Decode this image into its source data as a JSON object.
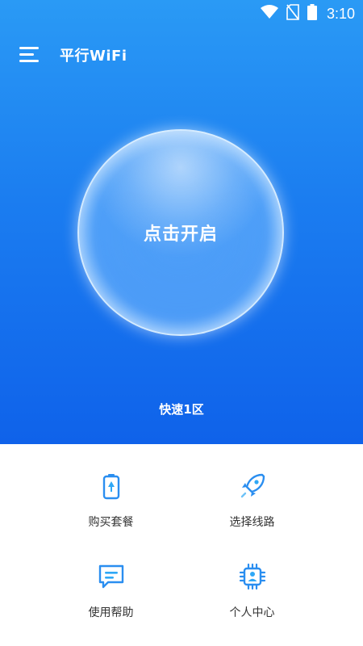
{
  "status_bar": {
    "time": "3:10",
    "icons": [
      "wifi-icon",
      "no-sim-icon",
      "battery-icon"
    ]
  },
  "app_bar": {
    "menu_icon": "menu-icon",
    "title": "平行WiFi"
  },
  "connect": {
    "button_label": "点击开启",
    "server_name": "快速1区"
  },
  "features": [
    {
      "label": "购买套餐",
      "icon": "battery-icon"
    },
    {
      "label": "选择线路",
      "icon": "rocket-icon"
    },
    {
      "label": "使用帮助",
      "icon": "chat-icon"
    },
    {
      "label": "个人中心",
      "icon": "chip-icon"
    }
  ],
  "colors": {
    "primary_blue": "#1b7df0",
    "icon_blue": "#2a8ef0",
    "text_dark": "#333333"
  }
}
